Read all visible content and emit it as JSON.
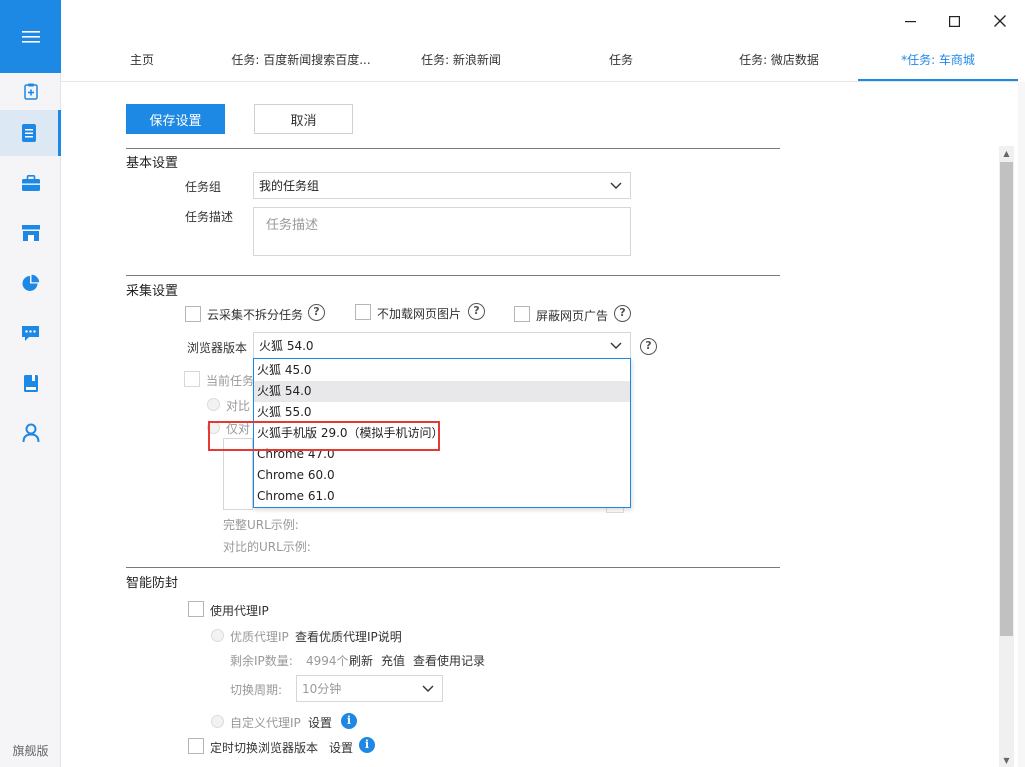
{
  "sidebar": {
    "edition": "旗舰版",
    "icons": [
      "menu-icon",
      "clipboard-add-icon",
      "document-icon",
      "toolbox-icon",
      "store-icon",
      "pie-chart-icon",
      "message-icon",
      "book-icon",
      "user-icon"
    ]
  },
  "tabs": [
    {
      "label": "主页"
    },
    {
      "label": "任务: 百度新闻搜索百度..."
    },
    {
      "label": "任务: 新浪新闻"
    },
    {
      "label": "任务"
    },
    {
      "label": "任务: 微店数据"
    },
    {
      "label": "*任务: 车商城"
    }
  ],
  "toolbar": {
    "save_label": "保存设置",
    "cancel_label": "取消"
  },
  "basic": {
    "title": "基本设置",
    "group_label": "任务组",
    "group_value": "我的任务组",
    "desc_label": "任务描述",
    "desc_placeholder": "任务描述"
  },
  "collect": {
    "title": "采集设置",
    "opt_cloud": "云采集不拆分任务",
    "opt_no_images": "不加载网页图片",
    "opt_block_ads": "屏蔽网页广告",
    "browser_label": "浏览器版本",
    "browser_value": "火狐 54.0",
    "current_task_partial": "当前任务",
    "compare_partial": "对比",
    "only_partial": "仅对",
    "full_url_label": "完整URL示例:",
    "compare_url_label": "对比的URL示例:"
  },
  "dropdown": {
    "options": [
      "火狐 45.0",
      "火狐 54.0",
      "火狐 55.0",
      "火狐手机版 29.0（模拟手机访问）",
      "Chrome 47.0",
      "Chrome 60.0",
      "Chrome 61.0"
    ]
  },
  "antiblock": {
    "title": "智能防封",
    "use_proxy": "使用代理IP",
    "quality_proxy": "优质代理IP",
    "quality_proxy_link": "查看优质代理IP说明",
    "remaining_label": "剩余IP数量:",
    "remaining_value": "4994个",
    "refresh": "刷新",
    "recharge": "充值",
    "view_records": "查看使用记录",
    "switch_period_label": "切换周期:",
    "switch_period_value": "10分钟",
    "custom_proxy": "自定义代理IP",
    "custom_proxy_settings": "设置",
    "timed_switch": "定时切换浏览器版本",
    "timed_switch_settings": "设置"
  }
}
